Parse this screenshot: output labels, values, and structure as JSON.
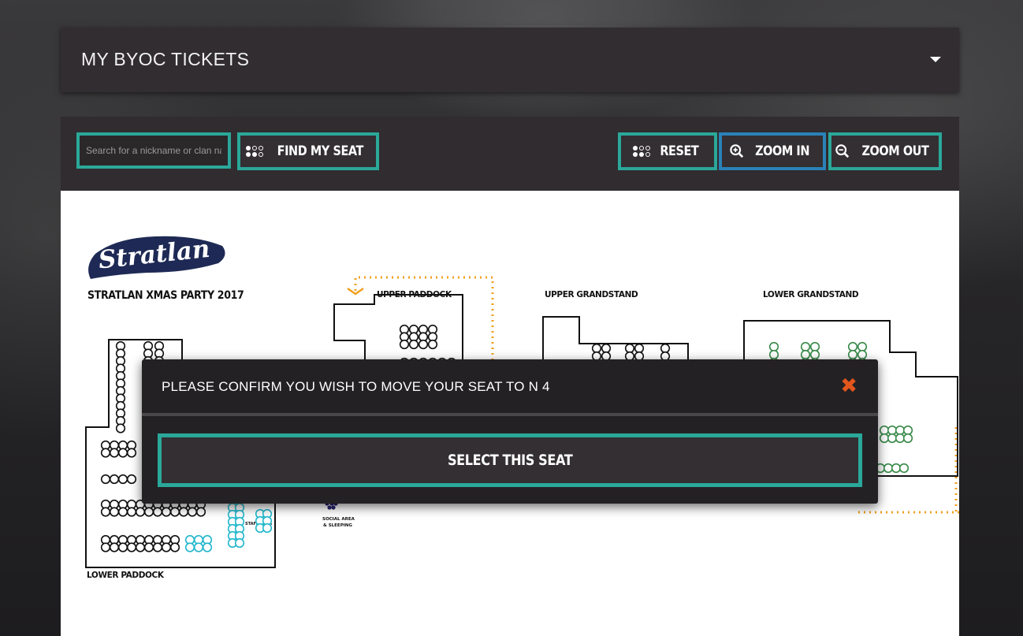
{
  "header": {
    "title": "MY BYOC TICKETS",
    "caret_icon": "caret-down-icon"
  },
  "toolbar": {
    "search_placeholder": "Search for a nickname or clan name",
    "find_label": "FIND MY SEAT",
    "reset_label": "RESET",
    "zoom_in_label": "ZOOM IN",
    "zoom_out_label": "ZOOM OUT"
  },
  "map": {
    "logo_text": "Stratlan",
    "event_title": "STRATLAN XMAS PARTY 2017",
    "zones": {
      "upper_paddock": "UPPER PADDOCK",
      "upper_grandstand": "UPPER GRANDSTAND",
      "lower_grandstand": "LOWER GRANDSTAND",
      "lower_paddock": "LOWER PADDOCK"
    },
    "small_labels": {
      "staff_area": "STAFF AREA",
      "social_area": "SOCIAL AREA",
      "sleeping": "& SLEEPING"
    }
  },
  "dialog": {
    "message": "PLEASE CONFIRM YOU WISH TO MOVE YOUR SEAT TO N 4",
    "close_symbol": "✖",
    "select_label": "SELECT THIS SEAT"
  },
  "colors": {
    "accent": "#2aa89a",
    "zoom_in_border": "#2a82b8",
    "close": "#e2561c"
  }
}
